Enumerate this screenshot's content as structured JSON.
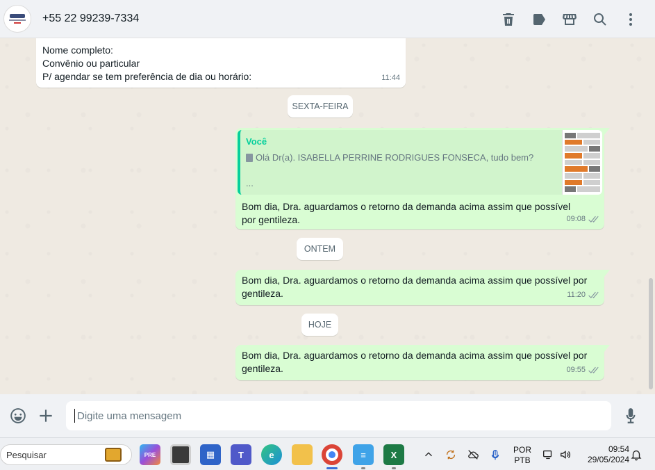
{
  "header": {
    "contact_name": "+55 22 99239-7334",
    "actions": [
      "delete-icon",
      "label-icon",
      "catalog-icon",
      "search-icon",
      "menu-icon"
    ]
  },
  "messages": {
    "incoming": {
      "lines": [
        "Nome completo:",
        "Convênio ou particular",
        "P/ agendar se tem preferência de dia ou horário:"
      ],
      "time": "11:44"
    },
    "chip_friday": "SEXTA-FEIRA",
    "out1": {
      "quote_author": "Você",
      "quote_text": "Olá Dr(a). ISABELLA PERRINE RODRIGUES FONSECA, tudo bem?",
      "quote_more": "...",
      "text": "Bom dia, Dra. aguardamos o retorno da demanda acima assim que possível por gentileza.",
      "time": "09:08"
    },
    "chip_yesterday": "ONTEM",
    "out2": {
      "text": "Bom dia, Dra. aguardamos o retorno da demanda acima assim que possível por gentileza.",
      "time": "11:20"
    },
    "chip_today": "HOJE",
    "out3": {
      "text": "Bom dia, Dra. aguardamos o retorno da demanda acima assim que possível por gentileza.",
      "time": "09:55"
    }
  },
  "composer": {
    "placeholder": "Digite uma mensagem"
  },
  "taskbar": {
    "search_placeholder": "Pesquisar",
    "lang_top": "POR",
    "lang_bottom": "PTB",
    "clock_time": "09:54",
    "clock_date": "29/05/2024"
  },
  "colors": {
    "outgoing_bubble": "#d9fdd3",
    "quote_accent": "#06cf9c",
    "chat_background": "#efeae2"
  }
}
